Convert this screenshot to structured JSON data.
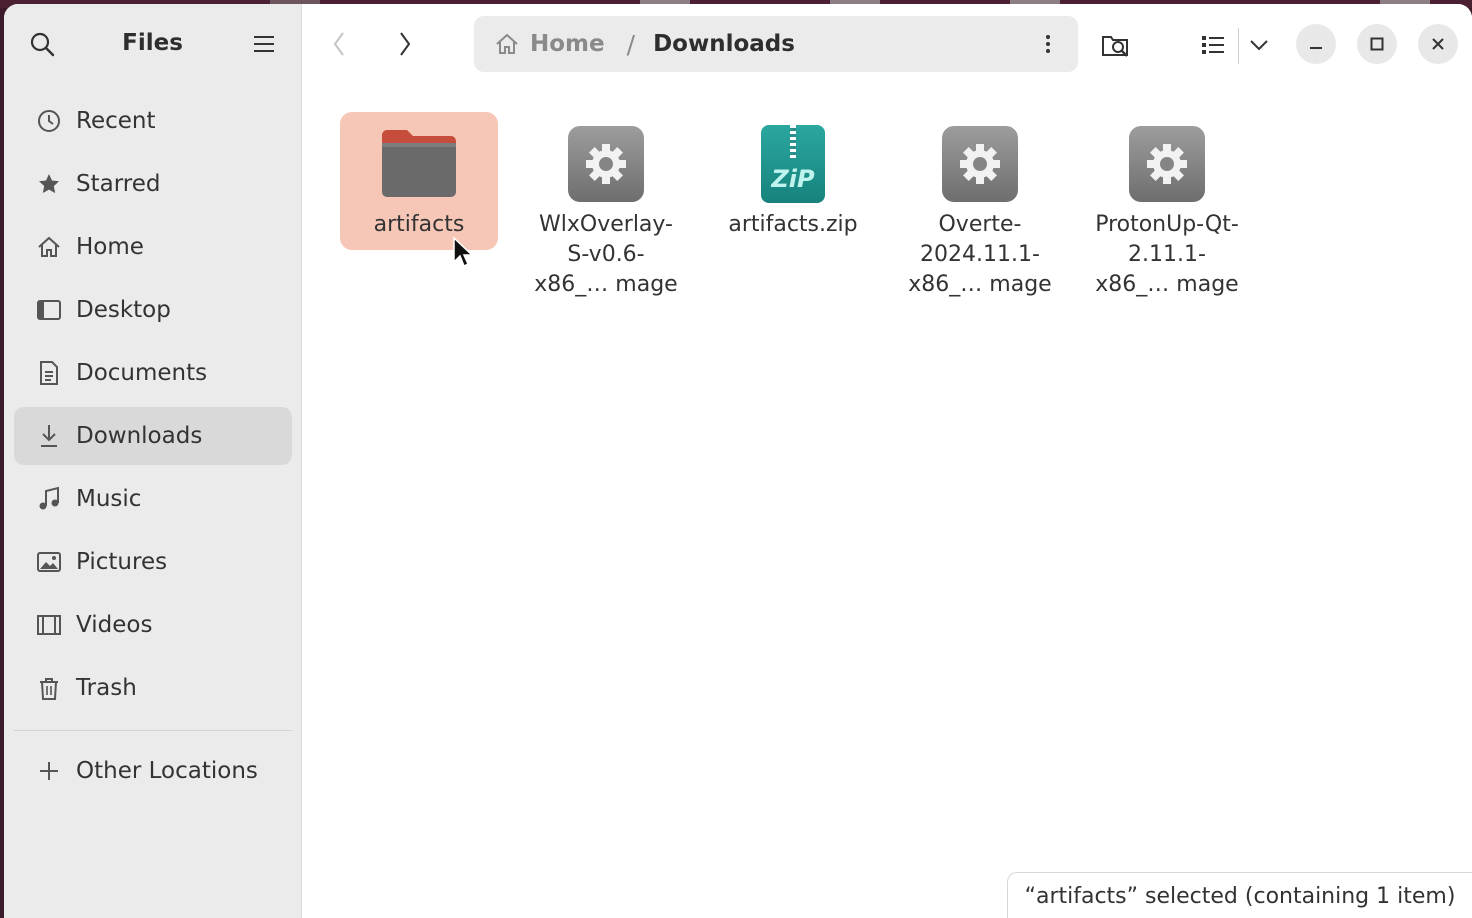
{
  "app": {
    "title": "Files"
  },
  "sidebar": {
    "items": [
      {
        "label": "Recent",
        "icon": "clock-icon"
      },
      {
        "label": "Starred",
        "icon": "star-icon"
      },
      {
        "label": "Home",
        "icon": "home-icon"
      },
      {
        "label": "Desktop",
        "icon": "desktop-icon"
      },
      {
        "label": "Documents",
        "icon": "document-icon"
      },
      {
        "label": "Downloads",
        "icon": "download-icon",
        "active": true
      },
      {
        "label": "Music",
        "icon": "music-icon"
      },
      {
        "label": "Pictures",
        "icon": "picture-icon"
      },
      {
        "label": "Videos",
        "icon": "video-icon"
      },
      {
        "label": "Trash",
        "icon": "trash-icon"
      }
    ],
    "other_locations": "Other Locations"
  },
  "pathbar": {
    "home": "Home",
    "separator": "/",
    "current": "Downloads"
  },
  "files": [
    {
      "name": "artifacts",
      "type": "folder",
      "selected": true
    },
    {
      "name": "WlxOverlay-S-v0.6-x86_… mage",
      "type": "executable"
    },
    {
      "name": "artifacts.zip",
      "type": "zip",
      "badge": "ZiP"
    },
    {
      "name": "Overte-2024.11.1-x86_… mage",
      "type": "executable"
    },
    {
      "name": "ProtonUp-Qt-2.11.1-x86_… mage",
      "type": "executable"
    }
  ],
  "status": {
    "text": "“artifacts” selected  (containing 1 item)"
  },
  "colors": {
    "selection": "#f6c6b6",
    "folder": "#6a6a6a",
    "folder_tab": "#c64d3b",
    "zip": "#1f9690"
  }
}
